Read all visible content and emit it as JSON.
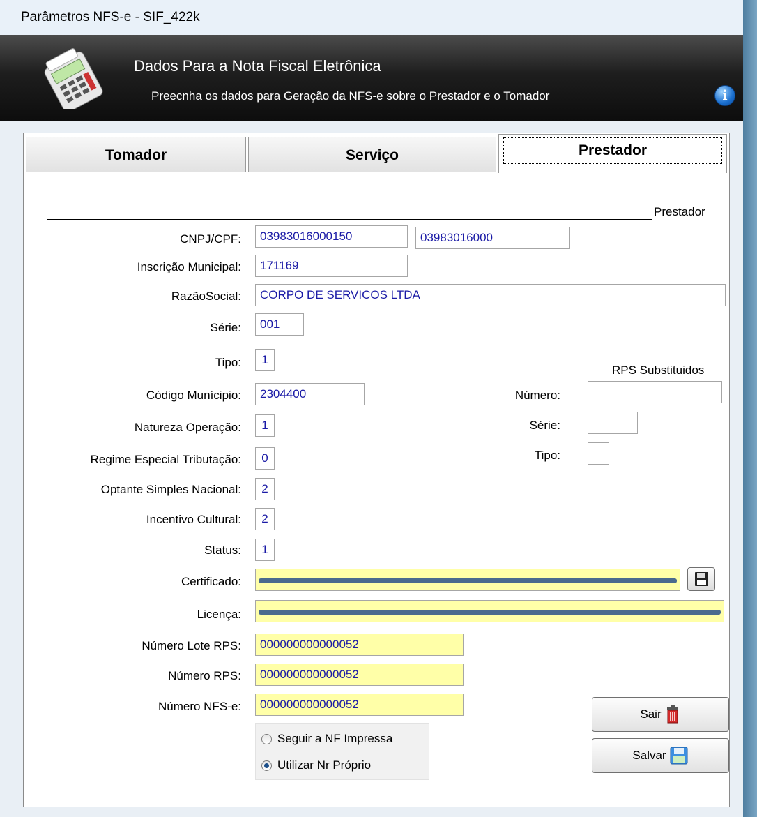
{
  "window": {
    "title": "Parâmetros NFS-e - SIF_422k"
  },
  "header": {
    "title": "Dados Para a Nota Fiscal Eletrônica",
    "subtitle": "Preecnha os dados para Geração da NFS-e sobre o Prestador e o Tomador",
    "pos_icon": "card-terminal-icon",
    "info_icon": "info-icon"
  },
  "tabs": [
    {
      "label": "Tomador",
      "active": false
    },
    {
      "label": "Serviço",
      "active": false
    },
    {
      "label": "Prestador",
      "active": true
    }
  ],
  "sections": {
    "prestador": "Prestador",
    "rps_substituidos": "RPS Substituidos"
  },
  "labels": {
    "cnpj_cpf": "CNPJ/CPF:",
    "inscricao_municipal": "Inscrição Municipal:",
    "razao_social": "RazãoSocial:",
    "serie": "Série:",
    "tipo": "Tipo:",
    "codigo_municipio": "Código Munícipio:",
    "natureza_operacao": "Natureza Operação:",
    "regime_especial": "Regime Especial Tributação:",
    "optante_simples": "Optante Simples Nacional:",
    "incentivo_cultural": "Incentivo Cultural:",
    "status": "Status:",
    "certificado": "Certificado:",
    "licenca": "Licença:",
    "numero_lote_rps": "Número Lote RPS:",
    "numero_rps": "Número RPS:",
    "numero_nfse": "Número NFS-e:",
    "rps_numero": "Número:",
    "rps_serie": "Série:",
    "rps_tipo": "Tipo:"
  },
  "values": {
    "cnpj_cpf": "03983016000150",
    "cnpj_cpf_2": "03983016000",
    "inscricao_municipal": "171169",
    "razao_social": "CORPO DE SERVICOS LTDA",
    "serie": "001",
    "tipo": "1",
    "codigo_municipio": "2304400",
    "natureza_operacao": "1",
    "regime_especial": "0",
    "optante_simples": "2",
    "incentivo_cultural": "2",
    "status": "1",
    "certificado": "",
    "licenca": "",
    "numero_lote_rps": "000000000000052",
    "numero_rps": "000000000000052",
    "numero_nfse": "000000000000052",
    "rps_numero": "",
    "rps_serie": "",
    "rps_tipo": ""
  },
  "radio": {
    "option1": "Seguir a NF Impressa",
    "option2": "Utilizar Nr Próprio",
    "selected": "option2"
  },
  "buttons": {
    "sair": "Sair",
    "sair_icon": "trash-icon",
    "salvar": "Salvar",
    "salvar_icon": "floppy-disk-icon",
    "certificado_icon": "floppy-disk-icon"
  }
}
